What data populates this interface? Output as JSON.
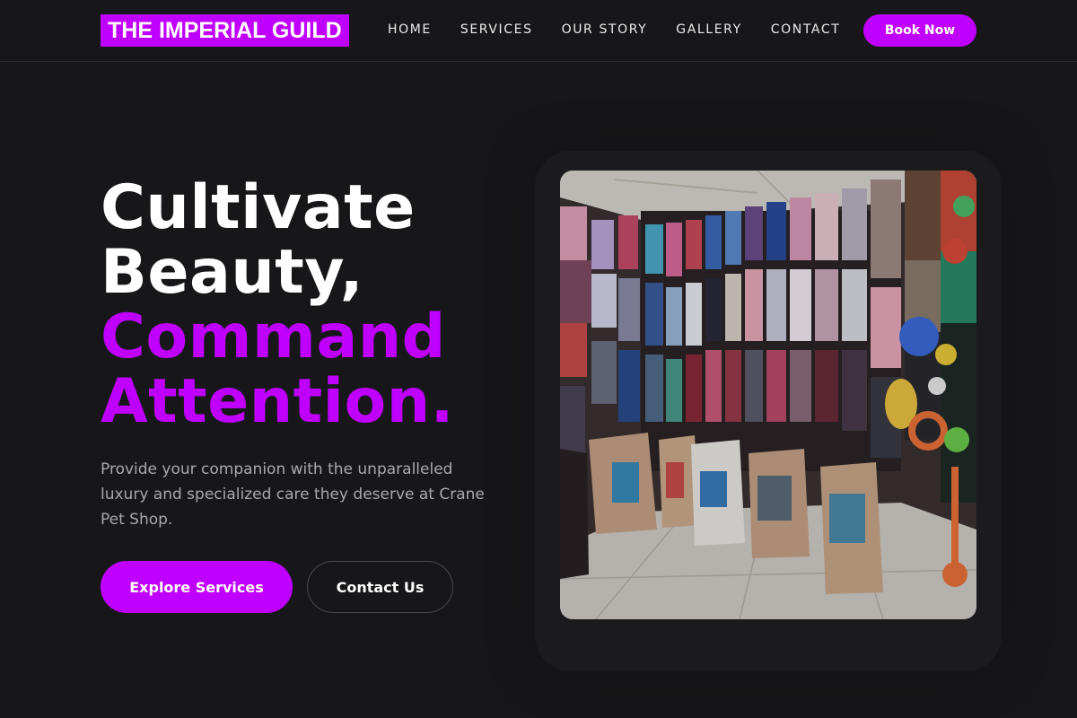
{
  "nav": {
    "logo": "THE IMPERIAL GUILD",
    "links": [
      "HOME",
      "SERVICES",
      "OUR STORY",
      "GALLERY",
      "CONTACT"
    ],
    "cta": "Book Now"
  },
  "hero": {
    "headline": [
      "Cultivate",
      "Beauty,"
    ],
    "headline_accent": [
      "Command",
      "Attention."
    ],
    "subtitle": "Provide your companion with the unparalleled luxury and specialized care they deserve at Crane Pet Shop.",
    "primary_button": "Explore Services",
    "secondary_button": "Contact Us",
    "image_alt": "pet-shop-interior-photo"
  },
  "colors": {
    "background": "#171719",
    "accent": "#c000ff",
    "text": "#ffffff",
    "muted": "#a8a8ae"
  }
}
